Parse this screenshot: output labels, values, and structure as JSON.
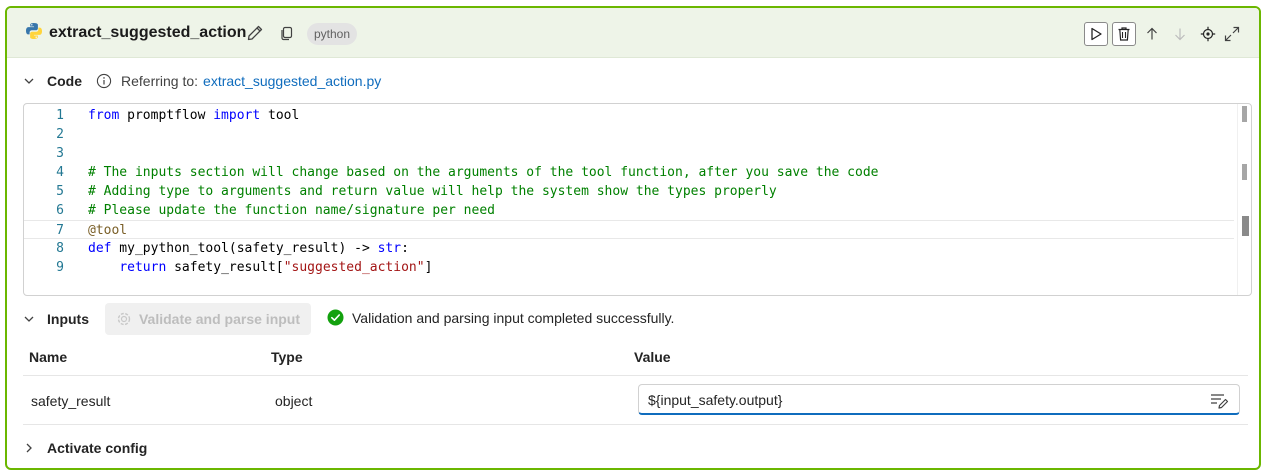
{
  "header": {
    "title": "extract_suggested_action",
    "language_badge": "python"
  },
  "code_section": {
    "label": "Code",
    "referring_text": "Referring to:",
    "file_link": "extract_suggested_action.py",
    "lines": [
      {
        "num": "1",
        "parts": [
          {
            "t": "from",
            "c": "kw"
          },
          {
            "t": " promptflow ",
            "c": "fn"
          },
          {
            "t": "import",
            "c": "kw"
          },
          {
            "t": " tool",
            "c": "fn"
          }
        ]
      },
      {
        "num": "2",
        "parts": []
      },
      {
        "num": "3",
        "parts": []
      },
      {
        "num": "4",
        "parts": [
          {
            "t": "# The inputs section will change based on the arguments of the tool function, after you save the code",
            "c": "cm"
          }
        ]
      },
      {
        "num": "5",
        "parts": [
          {
            "t": "# Adding type to arguments and return value will help the system show the types properly",
            "c": "cm"
          }
        ]
      },
      {
        "num": "6",
        "parts": [
          {
            "t": "# Please update the function name/signature per need",
            "c": "cm"
          }
        ]
      },
      {
        "num": "7",
        "parts": [
          {
            "t": "@tool",
            "c": "dec"
          }
        ]
      },
      {
        "num": "8",
        "parts": [
          {
            "t": "def",
            "c": "kw"
          },
          {
            "t": " my_python_tool(safety_result) -> ",
            "c": "fn"
          },
          {
            "t": "str",
            "c": "kw"
          },
          {
            "t": ":",
            "c": "fn"
          }
        ]
      },
      {
        "num": "9",
        "parts": [
          {
            "t": "    ",
            "c": "fn"
          },
          {
            "t": "return",
            "c": "kw"
          },
          {
            "t": " safety_result[",
            "c": "fn"
          },
          {
            "t": "\"suggested_action\"",
            "c": "st"
          },
          {
            "t": "]",
            "c": "fn"
          }
        ]
      }
    ]
  },
  "inputs_section": {
    "label": "Inputs",
    "validate_button": "Validate and parse input",
    "status_message": "Validation and parsing input completed successfully.",
    "columns": [
      "Name",
      "Type",
      "Value"
    ],
    "rows": [
      {
        "name": "safety_result",
        "type": "object",
        "value": "${input_safety.output}"
      }
    ]
  },
  "activate_config": {
    "label": "Activate config"
  },
  "colors": {
    "card_border": "#6bb700",
    "header_bg": "#eef4e8",
    "link": "#0f6cbd",
    "success": "#13a10e"
  }
}
